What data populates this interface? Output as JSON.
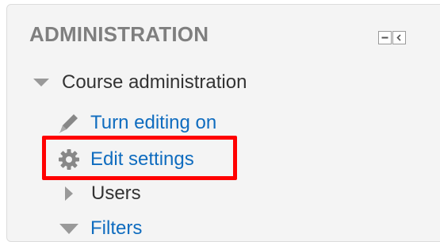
{
  "block": {
    "title": "ADMINISTRATION",
    "controls": [
      {
        "icon": "minimize-icon"
      },
      {
        "icon": "dock-left-icon"
      }
    ]
  },
  "tree": {
    "course_admin": {
      "label": "Course administration",
      "icon": "triangle-down-icon"
    },
    "turn_editing": {
      "label": "Turn editing on",
      "icon": "pencil-icon"
    },
    "edit_settings": {
      "label": "Edit settings",
      "icon": "gear-icon"
    },
    "users": {
      "label": "Users",
      "icon": "triangle-right-icon"
    },
    "filters": {
      "label": "Filters",
      "icon": "triangle-down-icon"
    }
  },
  "colors": {
    "link": "#0f6cbf",
    "text": "#333333",
    "title": "#7f7f7f",
    "panel": "#f4f4f4",
    "highlight": "#ff0000"
  }
}
